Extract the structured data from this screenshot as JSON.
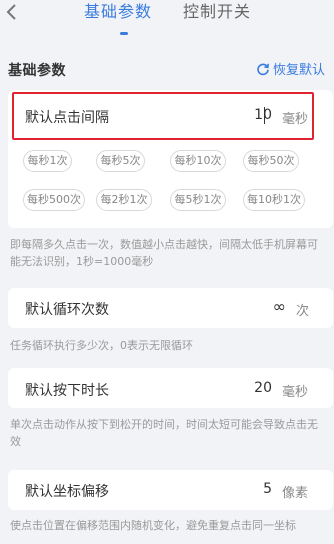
{
  "tabs": [
    {
      "label": "基础参数",
      "active": true
    },
    {
      "label": "控制开关",
      "active": false
    }
  ],
  "section": {
    "title": "基础参数",
    "restore_label": "恢复默认"
  },
  "interval": {
    "label": "默认点击间隔",
    "value": "10",
    "unit": "毫秒",
    "presets": [
      "每秒1次",
      "每秒5次",
      "每秒10次",
      "每秒50次",
      "每秒500次",
      "每2秒1次",
      "每5秒1次",
      "每10秒1次"
    ],
    "hint": "即每隔多久点击一次，数值越小点击越快，间隔太低手机屏幕可能无法识别，1秒=1000毫秒"
  },
  "loop": {
    "label": "默认循环次数",
    "value": "∞",
    "unit": "次",
    "hint": "任务循环执行多少次，0表示无限循环"
  },
  "press": {
    "label": "默认按下时长",
    "value": "20",
    "unit": "毫秒",
    "hint": "单次点击动作从按下到松开的时间，时间太短可能会导致点击无效"
  },
  "offset": {
    "label": "默认坐标偏移",
    "value": "5",
    "unit": "像素",
    "hint": "使点击位置在偏移范围内随机变化，避免重复点击同一坐标"
  },
  "colors": {
    "accent": "#3a7be0",
    "highlight": "#e0242f",
    "background": "#f1f3f6"
  }
}
